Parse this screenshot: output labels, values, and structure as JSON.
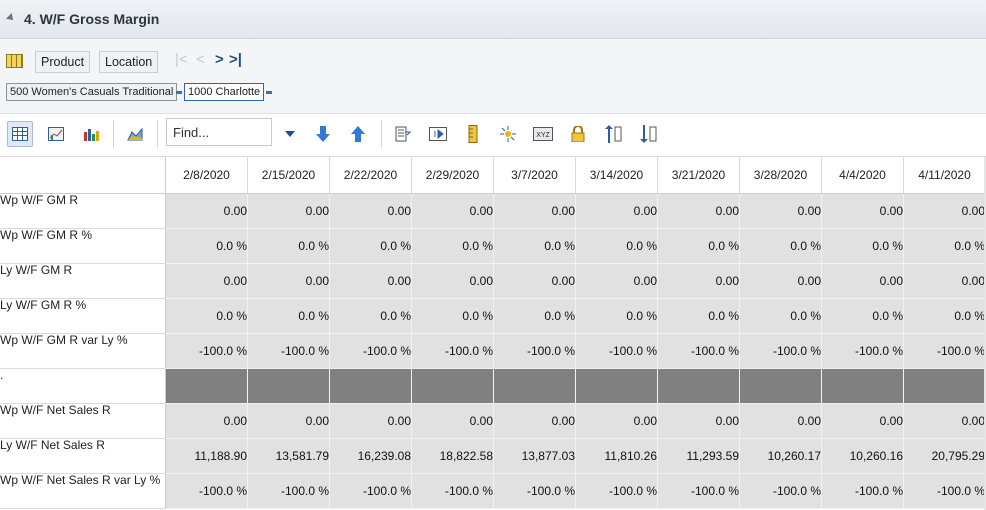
{
  "title": "4. W/F Gross Margin",
  "filters": {
    "product_label": "Product",
    "location_label": "Location",
    "nav": {
      "first": "|<",
      "prev": "<",
      "next": ">",
      "last": ">|"
    },
    "breadcrumbs": [
      "500 Women's Casuals Traditional",
      "1000 Charlotte"
    ]
  },
  "toolbar": {
    "find_placeholder": "Find...",
    "icons": [
      "grid-view-icon",
      "chart-view-icon",
      "bar-chart-icon",
      "area-chart-icon",
      "find-dropdown-icon",
      "arrow-down-icon",
      "arrow-up-icon",
      "export-icon",
      "columns-icon",
      "ruler-icon",
      "spread-icon",
      "xyz-icon",
      "lock-icon",
      "sort-asc-icon",
      "sort-desc-icon"
    ]
  },
  "grid": {
    "dates": [
      "2/8/2020",
      "2/15/2020",
      "2/22/2020",
      "2/29/2020",
      "3/7/2020",
      "3/14/2020",
      "3/21/2020",
      "3/28/2020",
      "4/4/2020",
      "4/11/2020"
    ],
    "rows": [
      {
        "label": "Wp W/F GM R",
        "values": [
          "0.00",
          "0.00",
          "0.00",
          "0.00",
          "0.00",
          "0.00",
          "0.00",
          "0.00",
          "0.00",
          "0.00"
        ]
      },
      {
        "label": "Wp W/F GM R %",
        "values": [
          "0.0 %",
          "0.0 %",
          "0.0 %",
          "0.0 %",
          "0.0 %",
          "0.0 %",
          "0.0 %",
          "0.0 %",
          "0.0 %",
          "0.0 %"
        ]
      },
      {
        "label": "Ly W/F GM R",
        "values": [
          "0.00",
          "0.00",
          "0.00",
          "0.00",
          "0.00",
          "0.00",
          "0.00",
          "0.00",
          "0.00",
          "0.00"
        ]
      },
      {
        "label": "Ly W/F GM R %",
        "values": [
          "0.0 %",
          "0.0 %",
          "0.0 %",
          "0.0 %",
          "0.0 %",
          "0.0 %",
          "0.0 %",
          "0.0 %",
          "0.0 %",
          "0.0 %"
        ]
      },
      {
        "label": "Wp W/F GM R var Ly %",
        "values": [
          "-100.0 %",
          "-100.0 %",
          "-100.0 %",
          "-100.0 %",
          "-100.0 %",
          "-100.0 %",
          "-100.0 %",
          "-100.0 %",
          "-100.0 %",
          "-100.0 %"
        ]
      },
      {
        "label": ".",
        "divider": true,
        "values": [
          "",
          "",
          "",
          "",
          "",
          "",
          "",
          "",
          "",
          ""
        ]
      },
      {
        "label": "Wp W/F Net Sales R",
        "values": [
          "0.00",
          "0.00",
          "0.00",
          "0.00",
          "0.00",
          "0.00",
          "0.00",
          "0.00",
          "0.00",
          "0.00"
        ]
      },
      {
        "label": "Ly W/F Net Sales R",
        "values": [
          "11,188.90",
          "13,581.79",
          "16,239.08",
          "18,822.58",
          "13,877.03",
          "11,810.26",
          "11,293.59",
          "10,260.17",
          "10,260.16",
          "20,795.29"
        ]
      },
      {
        "label": "Wp W/F Net Sales R var Ly %",
        "values": [
          "-100.0 %",
          "-100.0 %",
          "-100.0 %",
          "-100.0 %",
          "-100.0 %",
          "-100.0 %",
          "-100.0 %",
          "-100.0 %",
          "-100.0 %",
          "-100.0 %"
        ]
      }
    ]
  }
}
